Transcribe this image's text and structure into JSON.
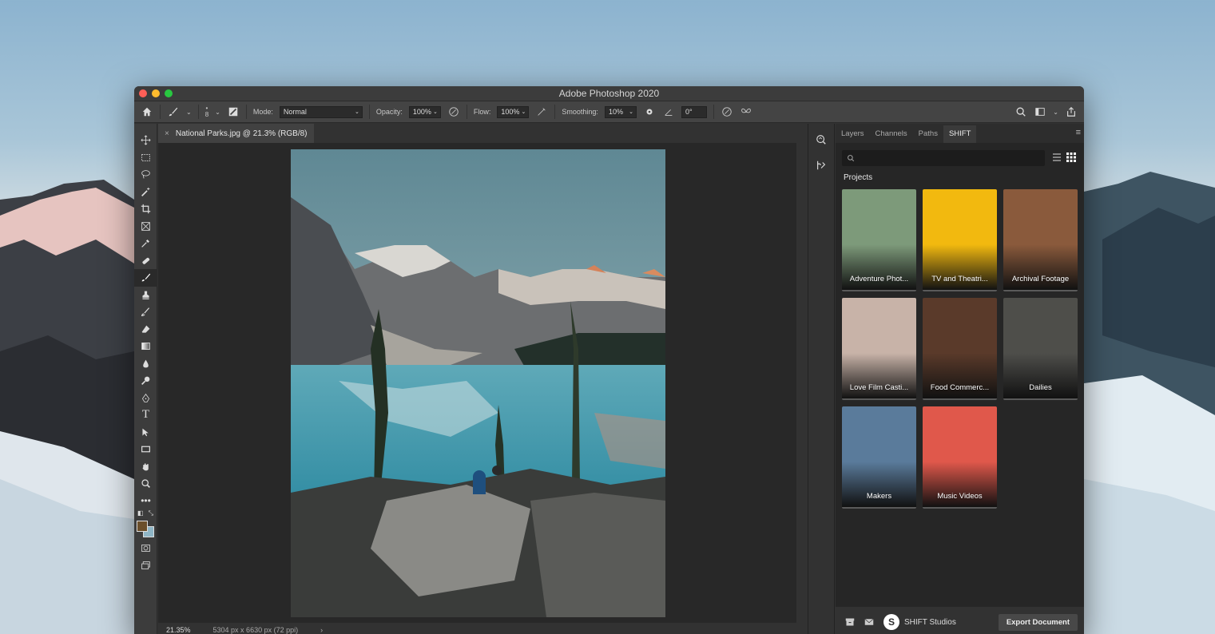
{
  "window": {
    "title": "Adobe Photoshop 2020"
  },
  "options_bar": {
    "brush_size": "8",
    "mode_label": "Mode:",
    "mode_value": "Normal",
    "opacity_label": "Opacity:",
    "opacity_value": "100%",
    "flow_label": "Flow:",
    "flow_value": "100%",
    "smoothing_label": "Smoothing:",
    "smoothing_value": "10%",
    "angle_value": "0°"
  },
  "document": {
    "tab_title": "National Parks.jpg @ 21.3% (RGB/8)",
    "close_glyph": "×",
    "zoom": "21.35%",
    "dimensions": "5304 px x 6630 px (72 ppi)",
    "arrow": "›"
  },
  "panel": {
    "tabs": [
      "Layers",
      "Channels",
      "Paths",
      "SHIFT"
    ],
    "active_tab": "SHIFT",
    "projects_title": "Projects",
    "projects": [
      {
        "label": "Adventure Phot...",
        "color": "#7d9a7a"
      },
      {
        "label": "TV and Theatri...",
        "color": "#f2b90f"
      },
      {
        "label": "Archival Footage",
        "color": "#8a5a3c"
      },
      {
        "label": "Love Film Casti...",
        "color": "#c8b3a8"
      },
      {
        "label": "Food Commerc...",
        "color": "#5a3a2a"
      },
      {
        "label": "Dailies",
        "color": "#4e4e4a"
      },
      {
        "label": "Makers",
        "color": "#5a7b9b"
      },
      {
        "label": "Music Videos",
        "color": "#e0584b"
      }
    ],
    "footer": {
      "brand_logo": "S",
      "brand_name": "SHIFT Studios",
      "export_label": "Export Document"
    }
  },
  "collapse_glyph": "«",
  "expand_glyph": "»"
}
